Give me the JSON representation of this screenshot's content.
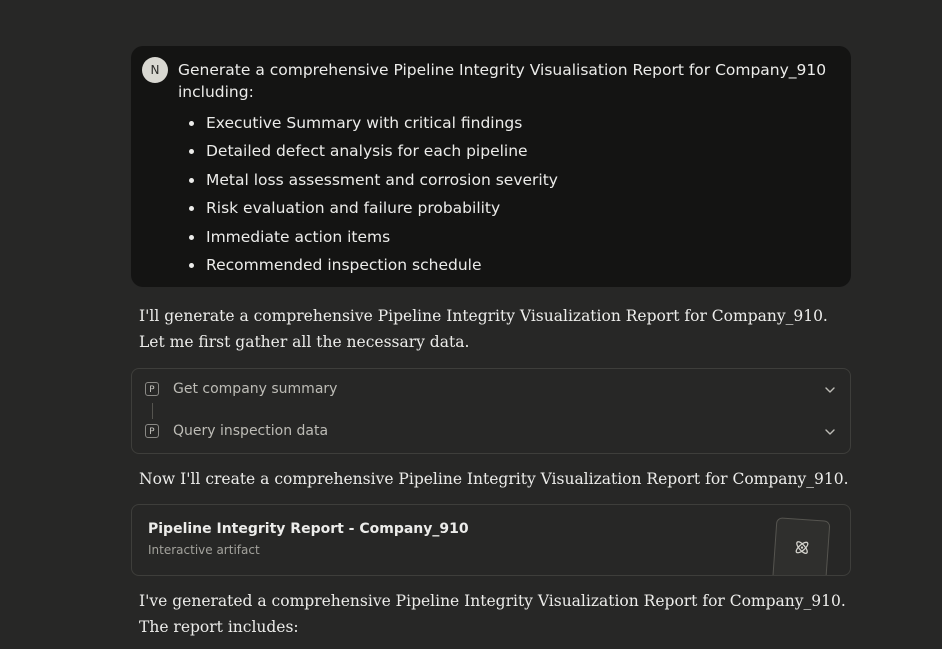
{
  "user_message": {
    "avatar_initial": "N",
    "text": "Generate a comprehensive Pipeline Integrity Visualisation Report for Company_910 including:",
    "bullets": [
      "Executive Summary with critical findings",
      "Detailed defect analysis for each pipeline",
      "Metal loss assessment and corrosion severity",
      "Risk evaluation and failure probability",
      "Immediate action items",
      "Recommended inspection schedule"
    ]
  },
  "assistant": {
    "intro_line1": "I'll generate a comprehensive Pipeline Integrity Visualization Report for Company_910.",
    "intro_line2": "Let me first gather all the necessary data.",
    "tools": [
      {
        "badge": "P",
        "label": "Get company summary",
        "icon": "chevron-down-icon"
      },
      {
        "badge": "P",
        "label": "Query inspection data",
        "icon": "chevron-down-icon"
      }
    ],
    "now_line": "Now I'll create a comprehensive Pipeline Integrity Visualization Report for Company_910.",
    "artifact": {
      "title": "Pipeline Integrity Report - Company_910",
      "subtitle": "Interactive artifact",
      "icon": "atom-icon"
    },
    "final_line1": "I've generated a comprehensive Pipeline Integrity Visualization Report for Company_910.",
    "final_line2": "The report includes:"
  },
  "colors": {
    "background": "#272726",
    "user_bubble": "#141413",
    "avatar": "#d9d8d2",
    "border": "#3e3e3b",
    "text": "#ececea",
    "muted_text": "#a3a29c"
  }
}
